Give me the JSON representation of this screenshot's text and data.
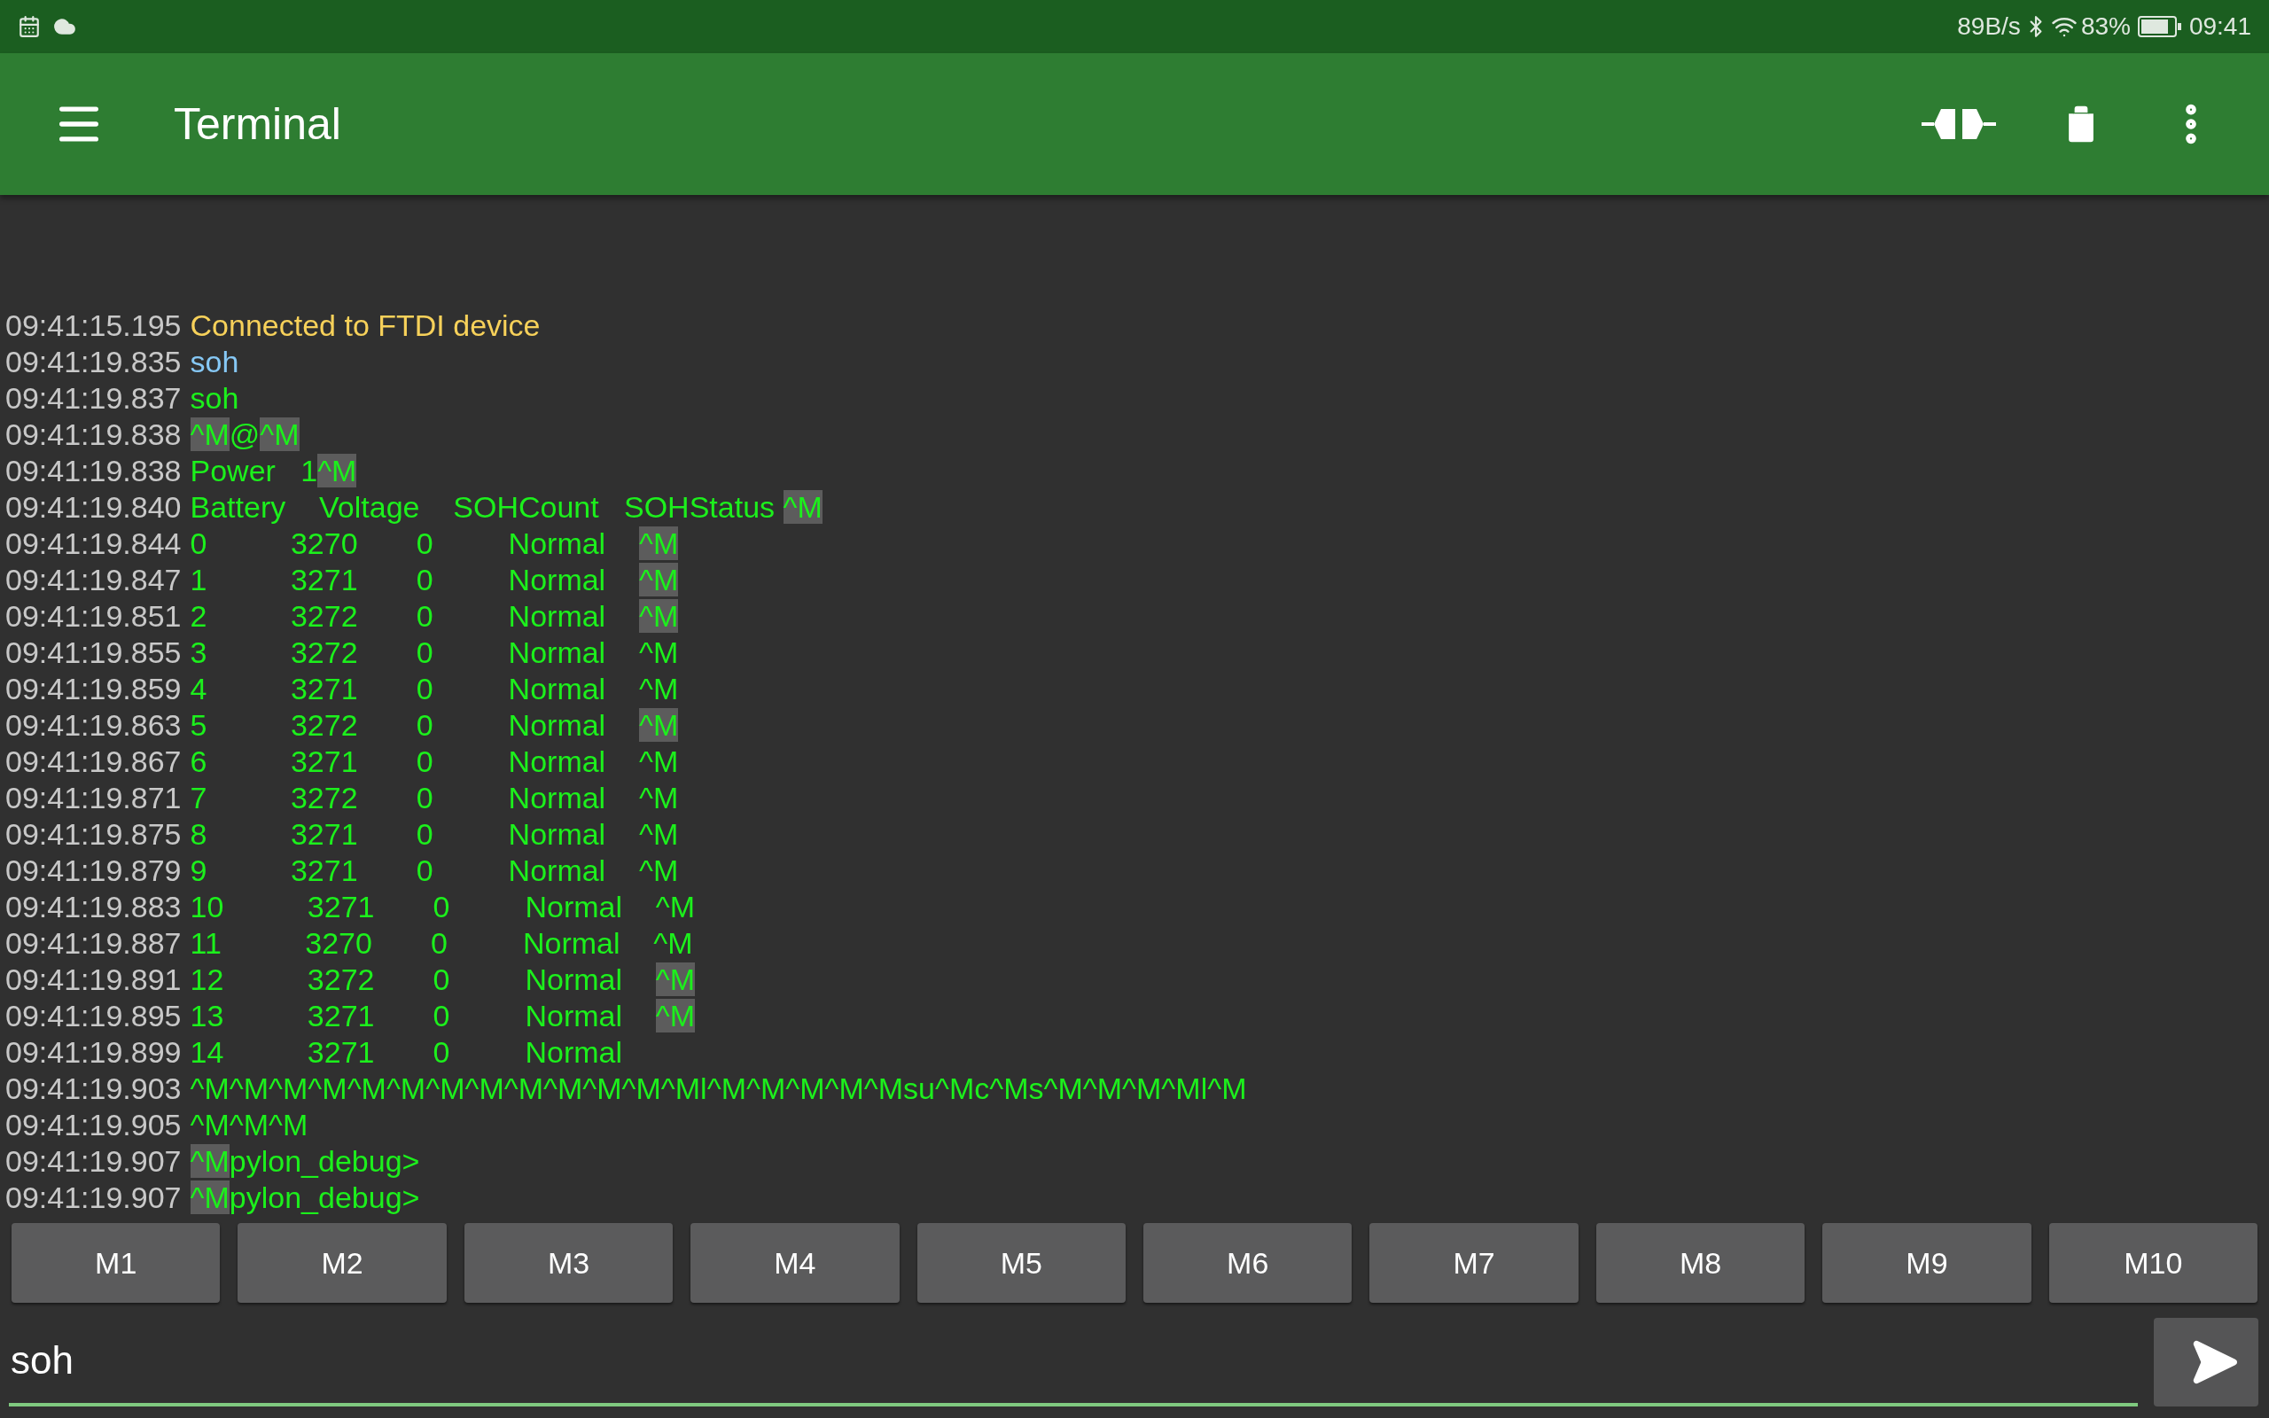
{
  "status_bar": {
    "net_speed": "89B/s",
    "battery": "83%",
    "time": "09:41"
  },
  "app_bar": {
    "title": "Terminal"
  },
  "terminal": {
    "lines": [
      {
        "time": "09:41:15.195",
        "kind": "status",
        "segments": [
          {
            "text": "Connected to FTDI device",
            "highlighted": false
          }
        ]
      },
      {
        "time": "09:41:19.835",
        "kind": "sent",
        "segments": [
          {
            "text": "soh",
            "highlighted": false
          }
        ]
      },
      {
        "time": "09:41:19.837",
        "kind": "received",
        "segments": [
          {
            "text": "soh",
            "highlighted": false
          }
        ]
      },
      {
        "time": "09:41:19.838",
        "kind": "received",
        "segments": [
          {
            "text": "^M",
            "highlighted": true
          },
          {
            "text": "@",
            "highlighted": false
          },
          {
            "text": "^M",
            "highlighted": true
          }
        ]
      },
      {
        "time": "09:41:19.838",
        "kind": "received",
        "segments": [
          {
            "text": "Power   1",
            "highlighted": false
          },
          {
            "text": "^M",
            "highlighted": true
          }
        ]
      },
      {
        "time": "09:41:19.840",
        "kind": "received",
        "segments": [
          {
            "text": "Battery    Voltage    SOHCount   SOHStatus ",
            "highlighted": false
          },
          {
            "text": "^M",
            "highlighted": true
          }
        ]
      },
      {
        "time": "09:41:19.844",
        "kind": "received",
        "segments": [
          {
            "text": "0          3270       0         Normal    ",
            "highlighted": false
          },
          {
            "text": "^M",
            "highlighted": true
          }
        ]
      },
      {
        "time": "09:41:19.847",
        "kind": "received",
        "segments": [
          {
            "text": "1          3271       0         Normal    ",
            "highlighted": false
          },
          {
            "text": "^M",
            "highlighted": true
          }
        ]
      },
      {
        "time": "09:41:19.851",
        "kind": "received",
        "segments": [
          {
            "text": "2          3272       0         Normal    ",
            "highlighted": false
          },
          {
            "text": "^M",
            "highlighted": true
          }
        ]
      },
      {
        "time": "09:41:19.855",
        "kind": "received",
        "segments": [
          {
            "text": "3          3272       0         Normal    ^M",
            "highlighted": false
          }
        ]
      },
      {
        "time": "09:41:19.859",
        "kind": "received",
        "segments": [
          {
            "text": "4          3271       0         Normal    ^M",
            "highlighted": false
          }
        ]
      },
      {
        "time": "09:41:19.863",
        "kind": "received",
        "segments": [
          {
            "text": "5          3272       0         Normal    ",
            "highlighted": false
          },
          {
            "text": "^M",
            "highlighted": true
          }
        ]
      },
      {
        "time": "09:41:19.867",
        "kind": "received",
        "segments": [
          {
            "text": "6          3271       0         Normal    ^M",
            "highlighted": false
          }
        ]
      },
      {
        "time": "09:41:19.871",
        "kind": "received",
        "segments": [
          {
            "text": "7          3272       0         Normal    ^M",
            "highlighted": false
          }
        ]
      },
      {
        "time": "09:41:19.875",
        "kind": "received",
        "segments": [
          {
            "text": "8          3271       0         Normal    ^M",
            "highlighted": false
          }
        ]
      },
      {
        "time": "09:41:19.879",
        "kind": "received",
        "segments": [
          {
            "text": "9          3271       0         Normal    ^M",
            "highlighted": false
          }
        ]
      },
      {
        "time": "09:41:19.883",
        "kind": "received",
        "segments": [
          {
            "text": "10          3271       0         Normal    ^M",
            "highlighted": false
          }
        ]
      },
      {
        "time": "09:41:19.887",
        "kind": "received",
        "segments": [
          {
            "text": "11          3270       0         Normal    ^M",
            "highlighted": false
          }
        ]
      },
      {
        "time": "09:41:19.891",
        "kind": "received",
        "segments": [
          {
            "text": "12          3272       0         Normal    ",
            "highlighted": false
          },
          {
            "text": "^M",
            "highlighted": true
          }
        ]
      },
      {
        "time": "09:41:19.895",
        "kind": "received",
        "segments": [
          {
            "text": "13          3271       0         Normal    ",
            "highlighted": false
          },
          {
            "text": "^M",
            "highlighted": true
          }
        ]
      },
      {
        "time": "09:41:19.899",
        "kind": "received",
        "segments": [
          {
            "text": "14          3271       0         Normal",
            "highlighted": false
          }
        ]
      },
      {
        "time": "09:41:19.903",
        "kind": "received",
        "segments": [
          {
            "text": "^M^M^M^M^M^M^M^M^M^M^M^M^Ml^M^M^M^M^Msu^Mc^Ms^M^M^M^Ml^M",
            "highlighted": false
          }
        ]
      },
      {
        "time": "09:41:19.905",
        "kind": "received",
        "segments": [
          {
            "text": "^M^M^M",
            "highlighted": false
          }
        ]
      },
      {
        "time": "09:41:19.907",
        "kind": "received",
        "segments": [
          {
            "text": "^M",
            "highlighted": true
          },
          {
            "text": "pylon_debug>",
            "highlighted": false
          }
        ]
      },
      {
        "time": "09:41:19.907",
        "kind": "received",
        "segments": [
          {
            "text": "^M",
            "highlighted": true
          },
          {
            "text": "pylon_debug>",
            "highlighted": false
          }
        ]
      }
    ]
  },
  "macro_buttons": [
    "M1",
    "M2",
    "M3",
    "M4",
    "M5",
    "M6",
    "M7",
    "M8",
    "M9",
    "M10"
  ],
  "input": {
    "value": "soh"
  }
}
